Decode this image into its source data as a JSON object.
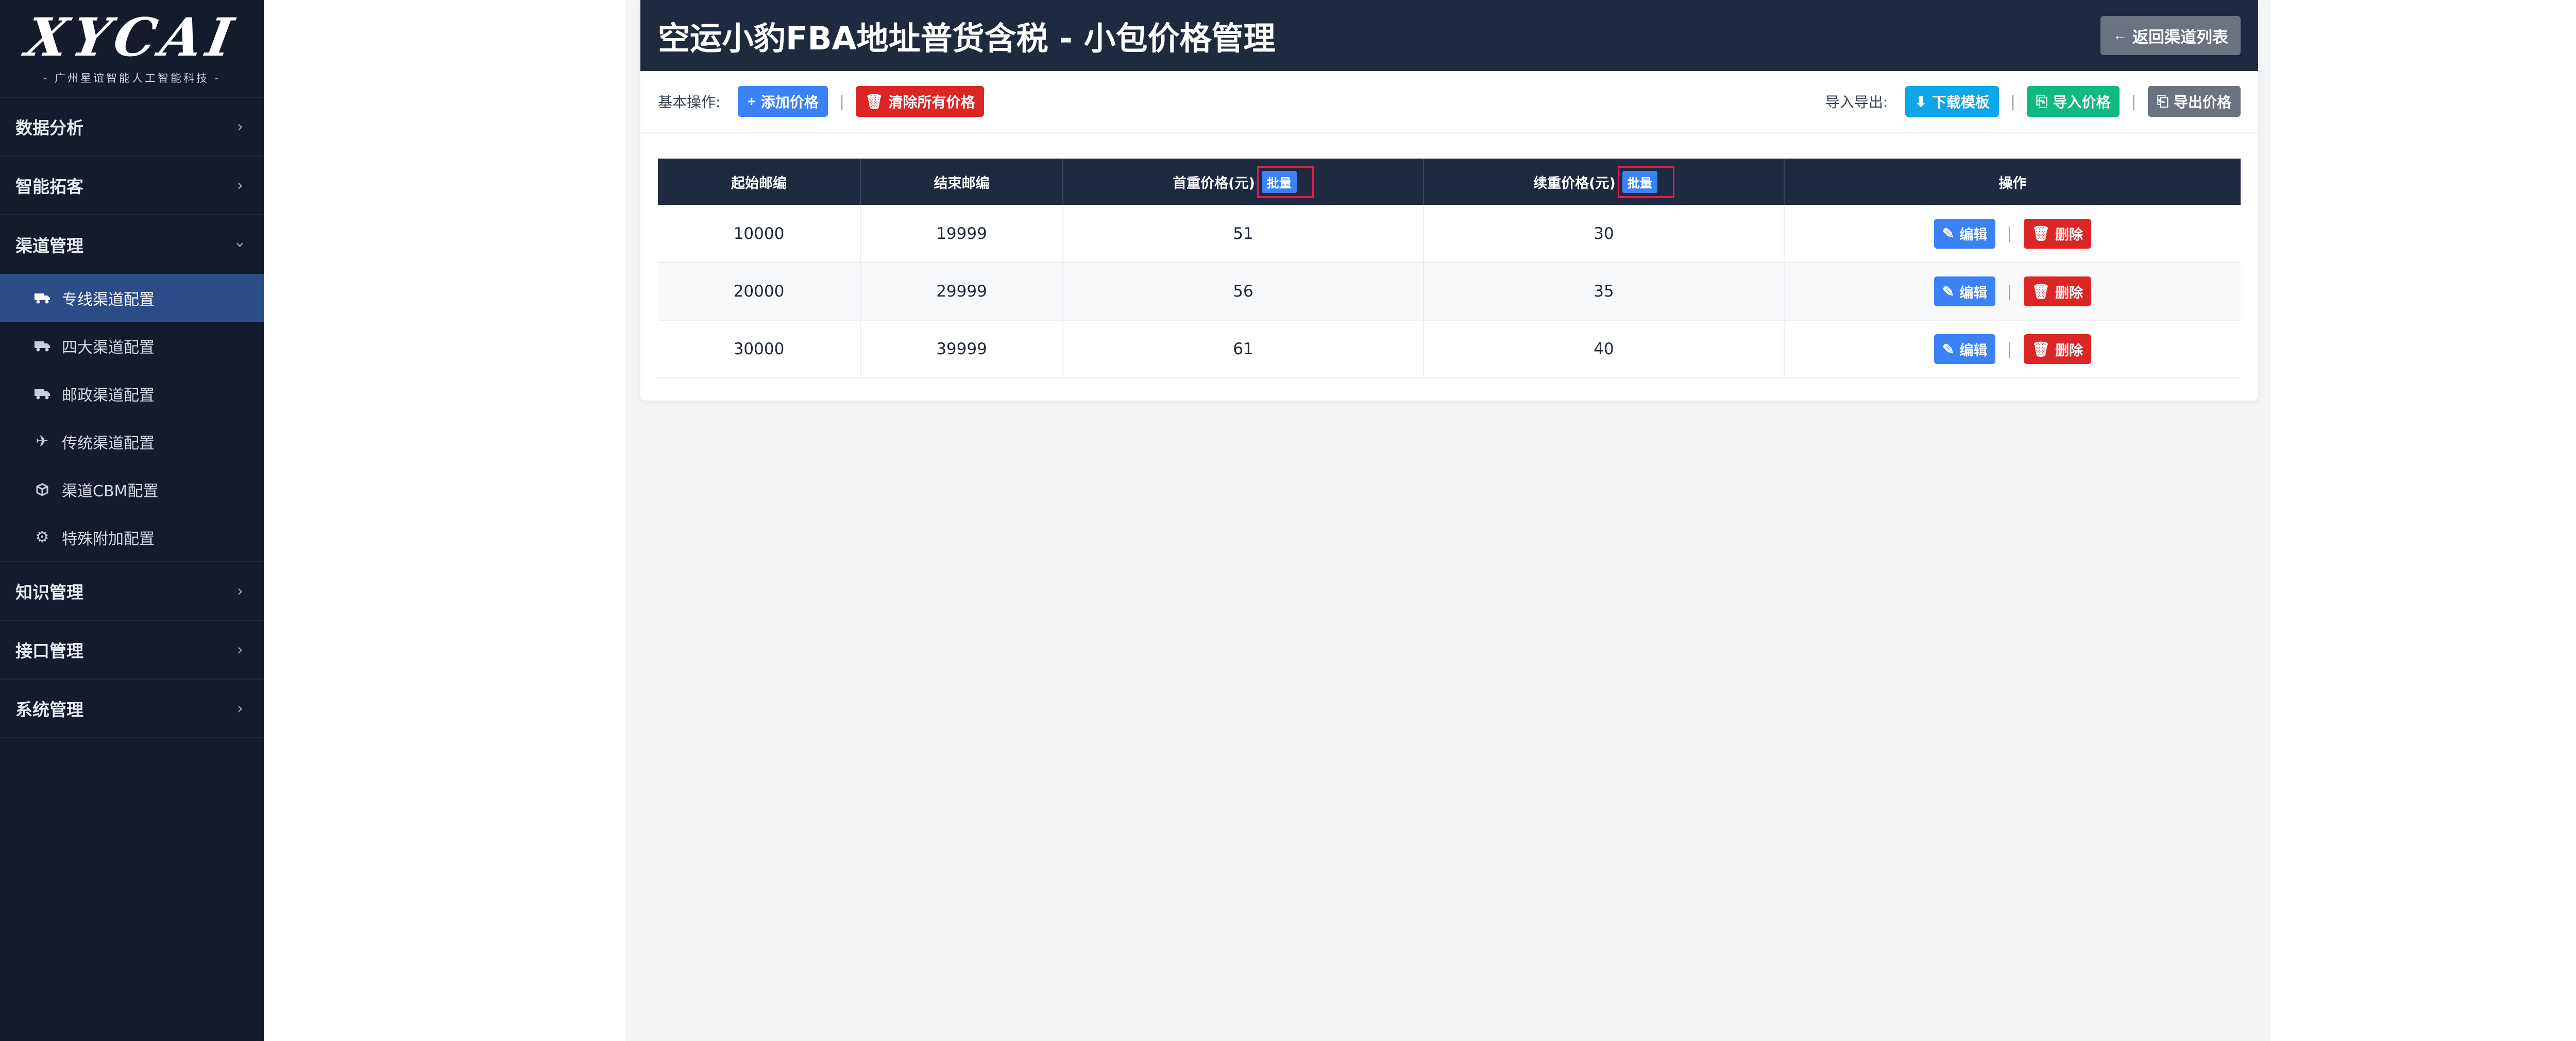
{
  "sidebar": {
    "logo": "XYCAI",
    "logo_sub": "- 广州星谊智能人工智能科技 -",
    "groups": [
      {
        "label": "数据分析"
      },
      {
        "label": "智能拓客"
      },
      {
        "label": "渠道管理"
      },
      {
        "label": "知识管理"
      },
      {
        "label": "接口管理"
      },
      {
        "label": "系统管理"
      }
    ],
    "channel_items": [
      {
        "label": "专线渠道配置",
        "icon": "truck-icon",
        "active": true
      },
      {
        "label": "四大渠道配置",
        "icon": "truck-icon"
      },
      {
        "label": "邮政渠道配置",
        "icon": "truck-icon"
      },
      {
        "label": "传统渠道配置",
        "icon": "plane-icon"
      },
      {
        "label": "渠道CBM配置",
        "icon": "cube-icon"
      },
      {
        "label": "特殊附加配置",
        "icon": "gear-icon"
      }
    ]
  },
  "header": {
    "title": "空运小豹FBA地址普货含税 - 小包价格管理",
    "back_label": "返回渠道列表"
  },
  "toolbar": {
    "basic_label": "基本操作:",
    "add_label": "添加价格",
    "clear_label": "清除所有价格",
    "io_label": "导入导出:",
    "download_label": "下载模板",
    "import_label": "导入价格",
    "export_label": "导出价格"
  },
  "table": {
    "headers": {
      "start": "起始邮编",
      "end": "结束邮编",
      "first": "首重价格(元)",
      "next": "续重价格(元)",
      "ops": "操作"
    },
    "batch_label": "批量",
    "edit_label": "编辑",
    "delete_label": "删除",
    "rows": [
      {
        "start": "10000",
        "end": "19999",
        "first": "51",
        "next": "30"
      },
      {
        "start": "20000",
        "end": "29999",
        "first": "56",
        "next": "35"
      },
      {
        "start": "30000",
        "end": "39999",
        "first": "61",
        "next": "40"
      }
    ]
  },
  "colors": {
    "sidebar_bg": "#141b2d",
    "active_bg": "#2b4c87",
    "header_bg": "#1f2a40",
    "primary": "#3b82f6",
    "danger": "#dc2626"
  }
}
